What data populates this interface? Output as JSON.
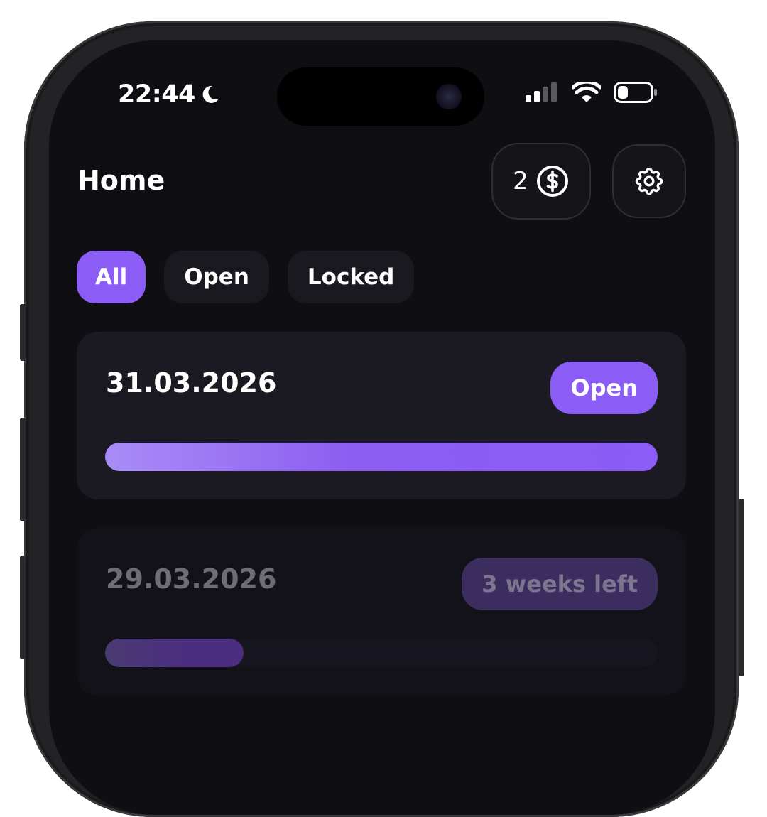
{
  "status_bar": {
    "time": "22:44",
    "focus_icon": "moon-icon",
    "signal_icon": "cellular-signal-icon",
    "wifi_icon": "wifi-icon",
    "battery_icon": "battery-icon"
  },
  "header": {
    "title": "Home",
    "coins_count": "2",
    "coins_icon": "dollar-coin-icon",
    "settings_icon": "gear-icon"
  },
  "filters": [
    {
      "label": "All",
      "active": true
    },
    {
      "label": "Open",
      "active": false
    },
    {
      "label": "Locked",
      "active": false
    }
  ],
  "cards": [
    {
      "date": "31.03.2026",
      "badge": "Open",
      "progress": 1.0,
      "locked": false
    },
    {
      "date": "29.03.2026",
      "badge": "3 weeks left",
      "progress": 0.25,
      "locked": true
    }
  ],
  "colors": {
    "accent": "#8b5cf6",
    "background": "#0f0e13",
    "card": "#1b1922"
  }
}
